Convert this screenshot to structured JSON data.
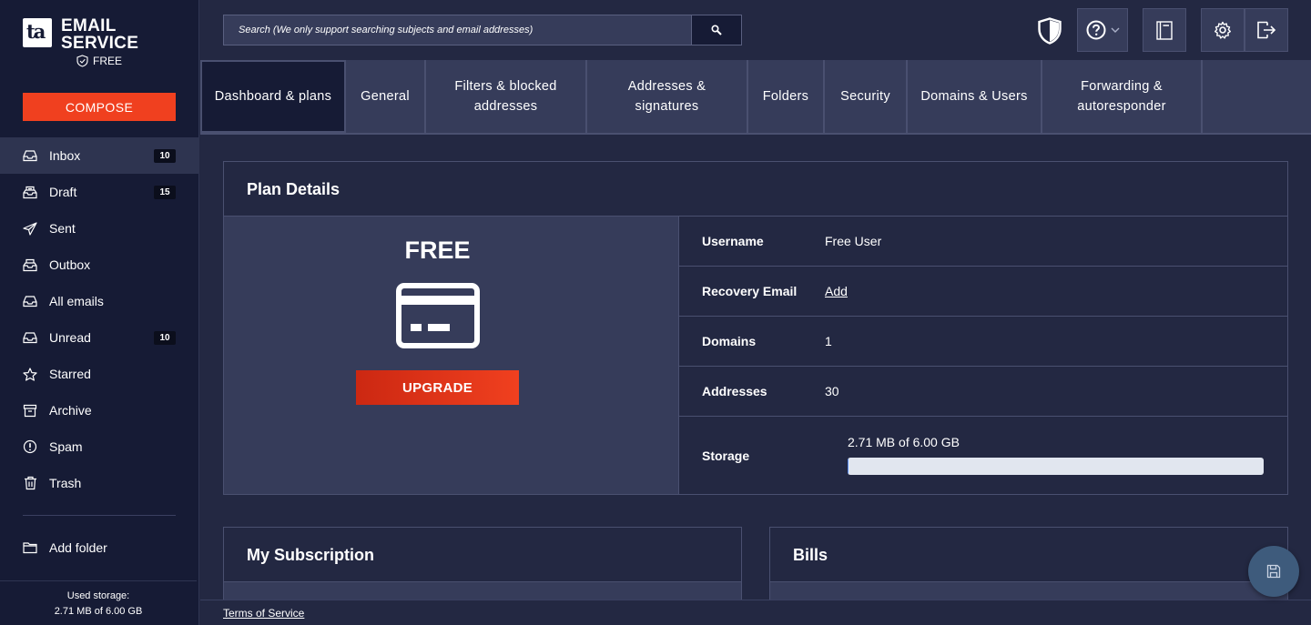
{
  "brand": {
    "line1": "EMAIL",
    "line2": "SERVICE",
    "plan": "FREE",
    "logo_letters": "ta"
  },
  "compose_label": "COMPOSE",
  "folders": [
    {
      "label": "Inbox",
      "count": "10",
      "icon": "inbox-icon"
    },
    {
      "label": "Draft",
      "count": "15",
      "icon": "draft-icon"
    },
    {
      "label": "Sent",
      "count": "",
      "icon": "send-icon"
    },
    {
      "label": "Outbox",
      "count": "",
      "icon": "outbox-icon"
    },
    {
      "label": "All emails",
      "count": "",
      "icon": "all-emails-icon"
    },
    {
      "label": "Unread",
      "count": "10",
      "icon": "unread-icon"
    },
    {
      "label": "Starred",
      "count": "",
      "icon": "star-icon"
    },
    {
      "label": "Archive",
      "count": "",
      "icon": "archive-icon"
    },
    {
      "label": "Spam",
      "count": "",
      "icon": "spam-icon"
    },
    {
      "label": "Trash",
      "count": "",
      "icon": "trash-icon"
    }
  ],
  "add_folder_label": "Add folder",
  "storage_footer": {
    "label": "Used storage:",
    "value": "2.71 MB of 6.00 GB"
  },
  "search": {
    "placeholder": "Search (We only support searching subjects and email addresses)"
  },
  "tabs": [
    {
      "label": "Dashboard & plans",
      "active": true
    },
    {
      "label": "General"
    },
    {
      "label": "Filters & blocked addresses"
    },
    {
      "label": "Addresses & signatures"
    },
    {
      "label": "Folders"
    },
    {
      "label": "Security"
    },
    {
      "label": "Domains & Users"
    },
    {
      "label": "Forwarding & autoresponder"
    }
  ],
  "plan_details": {
    "title": "Plan Details",
    "plan_name": "FREE",
    "upgrade_label": "UPGRADE",
    "rows": {
      "username": {
        "key": "Username",
        "value": "Free User"
      },
      "recovery": {
        "key": "Recovery Email",
        "value": "Add"
      },
      "domains": {
        "key": "Domains",
        "value": "1"
      },
      "addresses": {
        "key": "Addresses",
        "value": "30"
      },
      "storage": {
        "key": "Storage",
        "value": "2.71 MB of 6.00 GB",
        "used_fraction": 0.00045
      }
    }
  },
  "subscription_title": "My Subscription",
  "bills_title": "Bills",
  "terms_label": "Terms of Service",
  "colors": {
    "accent": "#f0401f",
    "sidebar": "#161b35",
    "panel": "#363c5a",
    "background": "#232842"
  }
}
